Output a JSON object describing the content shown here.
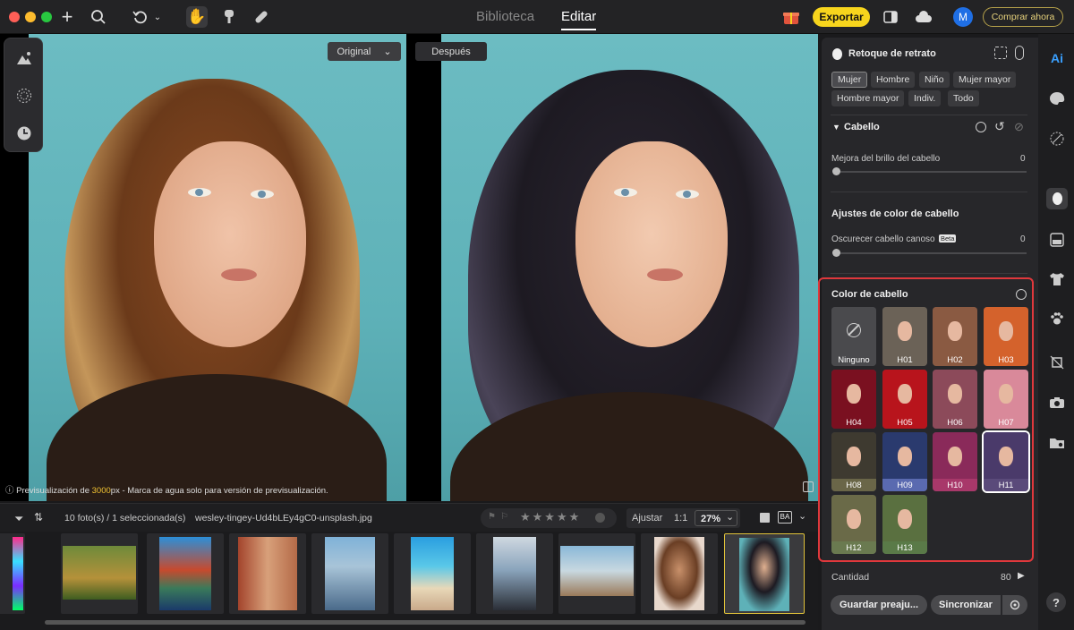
{
  "topbar": {
    "nav_tabs": [
      {
        "label": "Biblioteca"
      },
      {
        "label": "Editar"
      }
    ],
    "export_label": "Exportar",
    "buy_label": "Comprar ahora",
    "avatar_initial": "M"
  },
  "canvas": {
    "before_label": "Original",
    "after_label": "Después",
    "preview_note_prefix": "Previsualización de ",
    "preview_note_px": "3000",
    "preview_note_suffix": "px - Marca de agua solo para versión de previsualización."
  },
  "filmbar": {
    "count_label": "10 foto(s) / 1 seleccionada(s)",
    "filename": "wesley-tingey-Ud4bLEy4gC0-unsplash.jpg",
    "fit_label": "Ajustar",
    "ratio_label": "1:1",
    "zoom_label": "27%",
    "rating_stars": 5
  },
  "panel": {
    "title": "Retoque de retrato",
    "gender_chips": [
      {
        "label": "Mujer"
      },
      {
        "label": "Hombre"
      },
      {
        "label": "Niño"
      },
      {
        "label": "Mujer mayor"
      },
      {
        "label": "Hombre mayor"
      },
      {
        "label": "Indiv."
      },
      {
        "label": "Todo"
      }
    ],
    "hair_section": "Cabello",
    "brightness_label": "Mejora del brillo del cabello",
    "brightness_value": "0",
    "color_adjust_title": "Ajustes de color de cabello",
    "gray_label": "Oscurecer cabello canoso",
    "beta_badge": "Beta",
    "gray_value": "0",
    "hair_color_title": "Color de cabello",
    "swatches": [
      {
        "label": "Ninguno",
        "color": "#4a4a4d"
      },
      {
        "label": "H01",
        "color": "#6b6257"
      },
      {
        "label": "H02",
        "color": "#8a5a42"
      },
      {
        "label": "H03",
        "color": "#d4622c"
      },
      {
        "label": "H04",
        "color": "#7a1020"
      },
      {
        "label": "H05",
        "color": "#b8141c"
      },
      {
        "label": "H06",
        "color": "#8c4a5a"
      },
      {
        "label": "H07",
        "color": "#d9899a"
      },
      {
        "label": "H08",
        "color": "#3e3a30"
      },
      {
        "label": "H09",
        "color": "#2a3a6e"
      },
      {
        "label": "H10",
        "color": "#8a2a5a"
      },
      {
        "label": "H11",
        "color": "#4a3a6a"
      },
      {
        "label": "H12",
        "color": "#6a6a48"
      },
      {
        "label": "H13",
        "color": "#5a7040"
      }
    ],
    "amount_label": "Cantidad",
    "amount_value": "80",
    "save_preset_label": "Guardar preaju...",
    "sync_label": "Sincronizar"
  },
  "colors": {
    "accent": "#f7d51d",
    "highlight": "#e0383c",
    "selected": "#e0c23a"
  }
}
